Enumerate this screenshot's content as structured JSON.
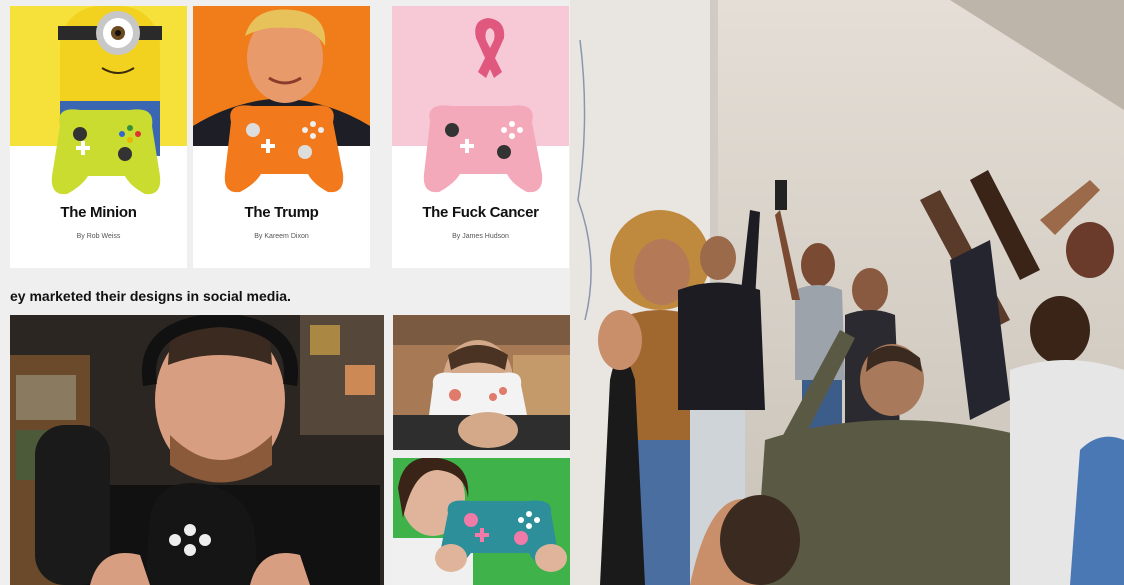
{
  "designs": [
    {
      "title": "The Minion",
      "author": "By Rob Weiss",
      "bg": "#f6e13a",
      "controller": "#c9dc2f"
    },
    {
      "title": "The Trump",
      "author": "By Kareem Dixon",
      "bg": "#f07d1a",
      "controller": "#f27a1c"
    },
    {
      "title": "The Fuck Cancer",
      "author": "By James Hudson",
      "bg": "#f7c9d6",
      "controller": "#f4a9bb"
    }
  ],
  "caption": "ey marketed their designs in social media."
}
